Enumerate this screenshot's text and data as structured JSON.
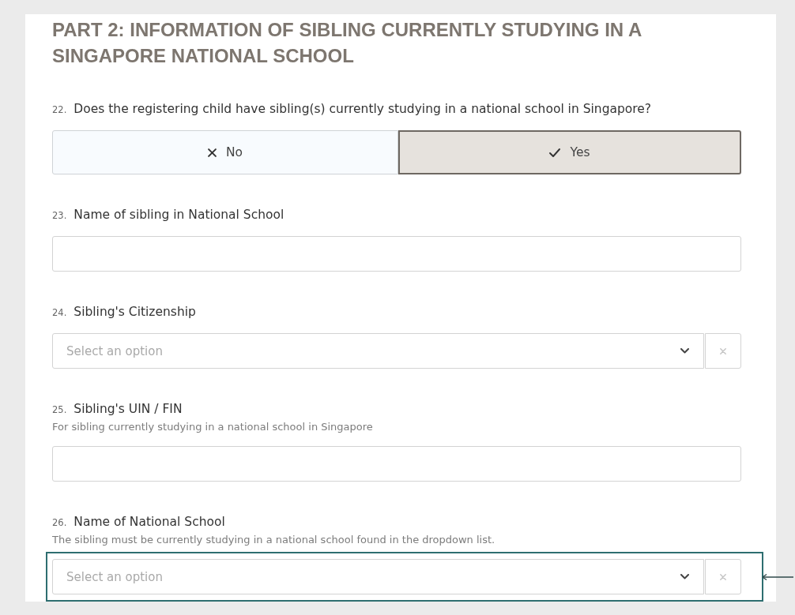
{
  "section": {
    "title": "PART 2: INFORMATION OF SIBLING CURRENTLY STUDYING IN A SINGAPORE NATIONAL SCHOOL"
  },
  "questions": [
    {
      "kind": "choice",
      "number": "22.",
      "label": "Does the registering child have sibling(s) currently studying in a national school in Singapore?",
      "options": [
        {
          "label": "No",
          "selected": false
        },
        {
          "label": "Yes",
          "selected": true
        }
      ]
    },
    {
      "kind": "text",
      "number": "23.",
      "label": "Name of sibling in National School"
    },
    {
      "kind": "select",
      "number": "24.",
      "label": "Sibling's Citizenship",
      "placeholder": "Select an option"
    },
    {
      "kind": "text",
      "number": "25.",
      "label": "Sibling's UIN / FIN",
      "description": "For sibling currently studying in a national school in Singapore"
    },
    {
      "kind": "select",
      "number": "26.",
      "label": "Name of National School",
      "description": "The sibling must be currently studying in a national school found in the dropdown list.",
      "placeholder": "Select an option",
      "highlighted": true
    }
  ]
}
